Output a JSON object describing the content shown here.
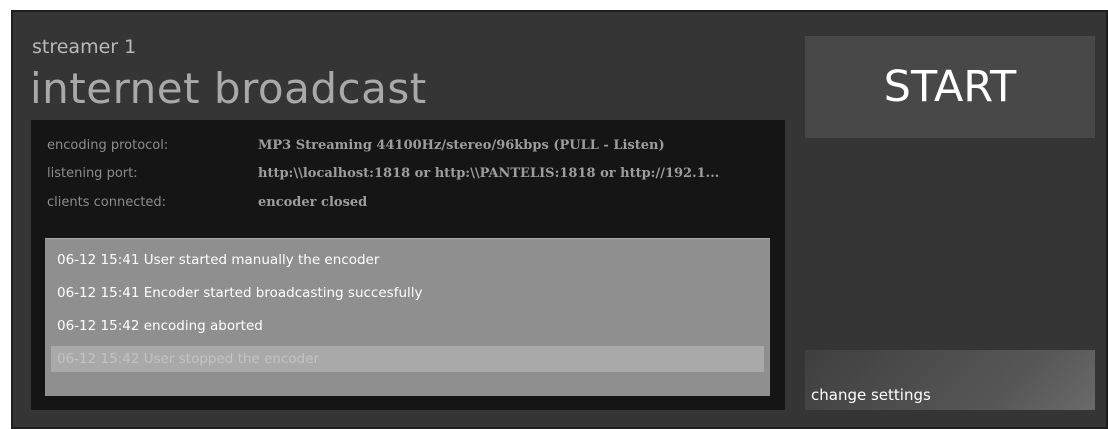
{
  "header": {
    "streamer_name": "streamer 1",
    "title": "internet broadcast"
  },
  "info": {
    "rows": [
      {
        "label": "encoding protocol:",
        "value": "MP3 Streaming 44100Hz/stereo/96kbps (PULL - Listen)"
      },
      {
        "label": "listening port:",
        "value": "http:\\\\localhost:1818 or http:\\\\PANTELIS:1818 or http://192.1..."
      },
      {
        "label": "clients connected:",
        "value": "encoder closed"
      }
    ]
  },
  "log": {
    "entries": [
      {
        "text": "06-12 15:41 User started manually the encoder"
      },
      {
        "text": "06-12 15:41 Encoder started broadcasting succesfully"
      },
      {
        "text": "06-12 15:42 encoding aborted"
      },
      {
        "text": "06-12 15:42 User stopped the encoder"
      }
    ],
    "selected_index": 3
  },
  "actions": {
    "start_label": "START",
    "settings_label": "change settings"
  },
  "colors": {
    "window_bg": "#353535",
    "panel_bg": "#151515",
    "log_bg": "#8f8f8f",
    "button_bg": "#484848"
  }
}
